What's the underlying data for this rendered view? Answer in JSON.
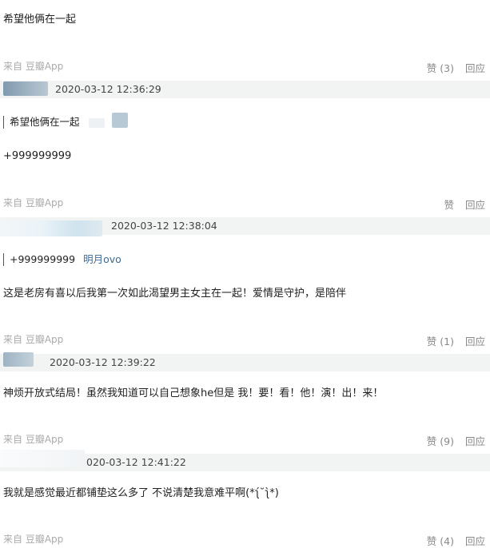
{
  "comments": [
    {
      "id": "c0",
      "text": "希望他俩在一起",
      "source": "来自 豆瓣App",
      "like": "赞 (3)",
      "reply": "回应"
    },
    {
      "id": "c1",
      "timestamp": "2020-03-12 12:36:29",
      "quote_text": "希望他俩在一起",
      "text": "+999999999",
      "source": "来自 豆瓣App",
      "like": "赞",
      "reply": "回应"
    },
    {
      "id": "c2",
      "timestamp": "2020-03-12 12:38:04",
      "quote_text": "+999999999",
      "quote_author": "明月ovo",
      "text": "这是老房有喜以后我第一次如此渴望男主女主在一起！爱情是守护，是陪伴",
      "source": "来自 豆瓣App",
      "like": "赞 (1)",
      "reply": "回应"
    },
    {
      "id": "c3",
      "timestamp": "2020-03-12 12:39:22",
      "text": "神烦开放式结局！虽然我知道可以自己想象he但是 我！要！看！他！演！出！来！",
      "source": "来自 豆瓣App",
      "like": "赞 (9)",
      "reply": "回应"
    },
    {
      "id": "c4",
      "timestamp": "020-03-12 12:41:22",
      "text": "我就是感觉最近都铺垫这么多了 不说清楚我意难平啊(*ʅ́˘ʅ̀*)",
      "source": "来自 豆瓣App",
      "like": "赞 (4)",
      "reply": "回应"
    }
  ]
}
